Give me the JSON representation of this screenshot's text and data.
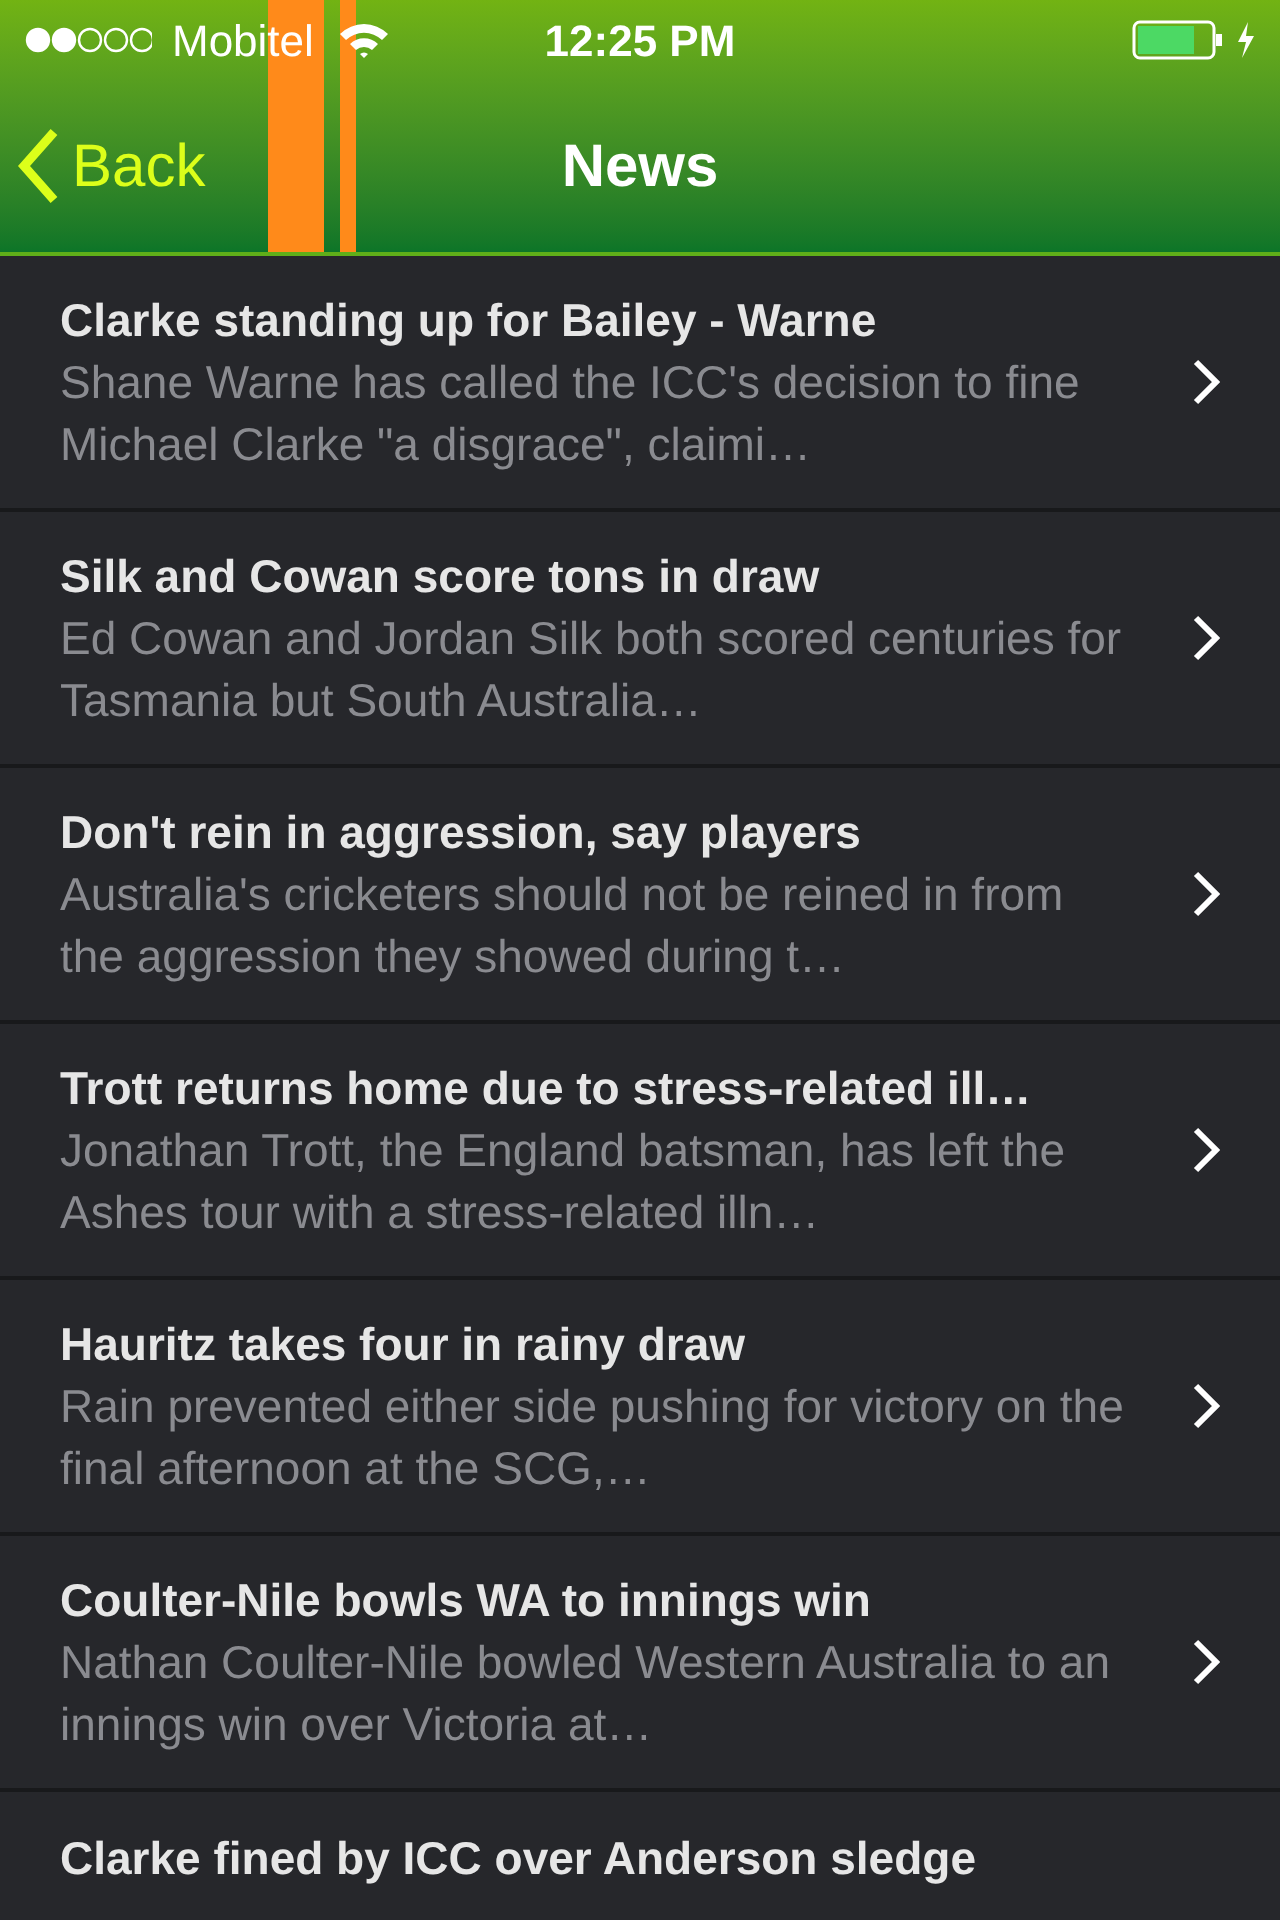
{
  "status_bar": {
    "carrier": "Mobitel",
    "time": "12:25 PM"
  },
  "nav_bar": {
    "back": "Back",
    "title": "News"
  },
  "articles": [
    {
      "title": "Clarke standing up for Bailey - Warne",
      "summary": "Shane Warne has called the ICC's decision to fine Michael Clarke \"a disgrace\", claimi…"
    },
    {
      "title": "Silk and Cowan score tons in draw",
      "summary": "Ed Cowan and Jordan Silk both scored centuries for Tasmania but South Australia…"
    },
    {
      "title": "Don't rein in aggression, say players",
      "summary": "Australia's cricketers should not be reined in from the aggression they showed during t…"
    },
    {
      "title": "Trott returns home due to stress-related ill…",
      "summary": "Jonathan Trott, the England batsman, has left the Ashes tour with a stress-related illn…"
    },
    {
      "title": "Hauritz takes four in rainy draw",
      "summary": "Rain prevented either side pushing for victory on the final afternoon at the SCG,…"
    },
    {
      "title": "Coulter-Nile bowls WA to innings win",
      "summary": "Nathan Coulter-Nile bowled Western Australia to an innings win over Victoria at…"
    },
    {
      "title": "Clarke fined by ICC over Anderson sledge"
    }
  ]
}
